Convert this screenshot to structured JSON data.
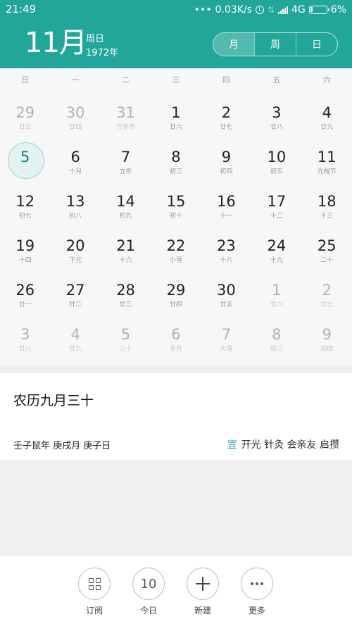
{
  "status_bar": {
    "time": "21:49",
    "network_speed": "0.03K/s",
    "network_type": "4G",
    "battery": "6%"
  },
  "header": {
    "month": "11月",
    "weekday": "周日",
    "year": "1972年",
    "view_tabs": [
      "月",
      "周",
      "日"
    ],
    "active_view": "月"
  },
  "calendar": {
    "weekday_headers": [
      "日",
      "一",
      "二",
      "三",
      "四",
      "五",
      "六"
    ],
    "selected_day": "5",
    "weeks": [
      [
        {
          "day": "29",
          "lunar": "廿三",
          "dim": true
        },
        {
          "day": "30",
          "lunar": "廿四",
          "dim": true
        },
        {
          "day": "31",
          "lunar": "万圣节",
          "dim": true
        },
        {
          "day": "1",
          "lunar": "廿六"
        },
        {
          "day": "2",
          "lunar": "廿七"
        },
        {
          "day": "3",
          "lunar": "廿八"
        },
        {
          "day": "4",
          "lunar": "廿九"
        }
      ],
      [
        {
          "day": "5",
          "lunar": "",
          "today": true
        },
        {
          "day": "6",
          "lunar": "十月"
        },
        {
          "day": "7",
          "lunar": "立冬"
        },
        {
          "day": "8",
          "lunar": "初三"
        },
        {
          "day": "9",
          "lunar": "初四"
        },
        {
          "day": "10",
          "lunar": "初五"
        },
        {
          "day": "11",
          "lunar": "光棍节"
        }
      ],
      [
        {
          "day": "12",
          "lunar": "初七"
        },
        {
          "day": "13",
          "lunar": "初八"
        },
        {
          "day": "14",
          "lunar": "初九"
        },
        {
          "day": "15",
          "lunar": "初十"
        },
        {
          "day": "16",
          "lunar": "十一"
        },
        {
          "day": "17",
          "lunar": "十二"
        },
        {
          "day": "18",
          "lunar": "十三"
        }
      ],
      [
        {
          "day": "19",
          "lunar": "十四"
        },
        {
          "day": "20",
          "lunar": "下元"
        },
        {
          "day": "21",
          "lunar": "十六"
        },
        {
          "day": "22",
          "lunar": "小雪"
        },
        {
          "day": "23",
          "lunar": "十八"
        },
        {
          "day": "24",
          "lunar": "十九"
        },
        {
          "day": "25",
          "lunar": "二十"
        }
      ],
      [
        {
          "day": "26",
          "lunar": "廿一"
        },
        {
          "day": "27",
          "lunar": "廿二"
        },
        {
          "day": "28",
          "lunar": "廿三"
        },
        {
          "day": "29",
          "lunar": "廿四"
        },
        {
          "day": "30",
          "lunar": "廿五"
        },
        {
          "day": "1",
          "lunar": "廿六",
          "dim": true
        },
        {
          "day": "2",
          "lunar": "廿七",
          "dim": true
        }
      ],
      [
        {
          "day": "3",
          "lunar": "廿八",
          "dim": true
        },
        {
          "day": "4",
          "lunar": "廿九",
          "dim": true
        },
        {
          "day": "5",
          "lunar": "三十",
          "dim": true
        },
        {
          "day": "6",
          "lunar": "冬月",
          "dim": true
        },
        {
          "day": "7",
          "lunar": "大雪",
          "dim": true
        },
        {
          "day": "8",
          "lunar": "初三",
          "dim": true
        },
        {
          "day": "9",
          "lunar": "初四",
          "dim": true
        }
      ]
    ]
  },
  "info": {
    "lunar_date": "农历九月三十",
    "ganzhi": "壬子鼠年 庚戌月 庚子日",
    "yi_label": "宜",
    "yi_items": "开光 针灸 会亲友 启攒"
  },
  "toolbar": {
    "subscribe_label": "订阅",
    "today_label": "今日",
    "today_number": "10",
    "new_label": "新建",
    "more_label": "更多"
  },
  "colors": {
    "accent": "#22a699",
    "today_circle": "#e3f3f1"
  }
}
